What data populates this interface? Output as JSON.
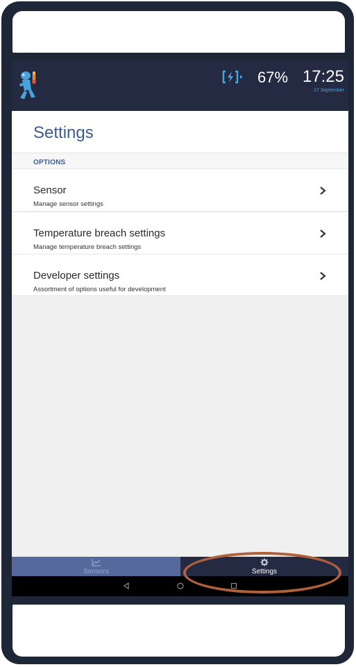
{
  "status_bar": {
    "battery_percent": "67%",
    "time": "17:25",
    "date": "17 September",
    "battery_icon": "charging-battery-icon"
  },
  "page": {
    "title": "Settings",
    "section_header": "OPTIONS"
  },
  "settings_items": [
    {
      "label": "Sensor",
      "description": "Manage sensor settings"
    },
    {
      "label": "Temperature breach settings",
      "description": "Manage temperature breach settings"
    },
    {
      "label": "Developer settings",
      "description": "Assortment of options useful for development"
    }
  ],
  "bottom_nav": {
    "tabs": [
      {
        "label": "Sensors",
        "icon": "line-chart-icon",
        "active": false
      },
      {
        "label": "Settings",
        "icon": "gear-icon",
        "active": true
      }
    ]
  },
  "system_nav": {
    "buttons": [
      "back-icon",
      "home-icon",
      "recents-icon"
    ]
  },
  "colors": {
    "app_bar": "#232a41",
    "title_accent": "#3e5d8f",
    "nav_inactive": "#56699d",
    "annotation": "#b0603a"
  }
}
